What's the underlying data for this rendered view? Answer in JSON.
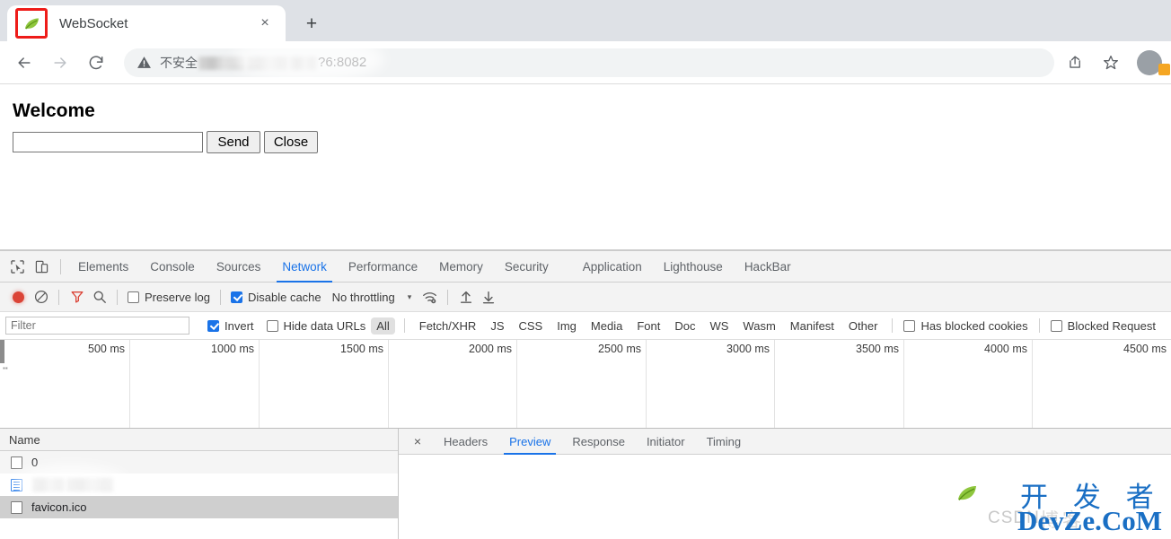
{
  "browser": {
    "tab": {
      "title": "WebSocket",
      "favicon": "spring-leaf-icon",
      "close_label": "×"
    },
    "new_tab_label": "+",
    "nav": {
      "back": "←",
      "forward": "→",
      "reload": "↻"
    },
    "omnibox": {
      "security_icon": "warning-triangle-icon",
      "security_text": "不安全",
      "url_visible_tail": "?6:8082",
      "url_redacted": true
    },
    "actions": {
      "share": "share-icon",
      "bookmark": "star-icon",
      "profile": "avatar"
    }
  },
  "page": {
    "heading": "Welcome",
    "message_input": {
      "value": "",
      "placeholder": ""
    },
    "send_label": "Send",
    "close_label": "Close"
  },
  "devtools": {
    "inspect_icon": "cursor-select-icon",
    "device_icon": "device-toggle-icon",
    "tabs": [
      {
        "label": "Elements",
        "active": false
      },
      {
        "label": "Console",
        "active": false
      },
      {
        "label": "Sources",
        "active": false
      },
      {
        "label": "Network",
        "active": true
      },
      {
        "label": "Performance",
        "active": false
      },
      {
        "label": "Memory",
        "active": false
      },
      {
        "label": "Security",
        "active": false
      },
      {
        "label": "Application",
        "active": false
      },
      {
        "label": "Lighthouse",
        "active": false
      },
      {
        "label": "HackBar",
        "active": false
      }
    ],
    "network_toolbar": {
      "record_icon": "record-button",
      "clear_icon": "clear-icon",
      "filter_icon": "filter-funnel-icon",
      "search_icon": "search-icon",
      "preserve_log": {
        "label": "Preserve log",
        "checked": false
      },
      "disable_cache": {
        "label": "Disable cache",
        "checked": true
      },
      "throttling": "No throttling",
      "caret": "▾",
      "wifi_icon": "network-conditions-icon",
      "import_icon": "import-har-icon",
      "export_icon": "export-har-icon"
    },
    "filter_bar": {
      "filter_placeholder": "Filter",
      "filter_value": "",
      "invert": {
        "label": "Invert",
        "checked": true
      },
      "hide_data_urls": {
        "label": "Hide data URLs",
        "checked": false
      },
      "types": [
        {
          "label": "All",
          "selected": true
        },
        {
          "label": "Fetch/XHR",
          "selected": false
        },
        {
          "label": "JS",
          "selected": false
        },
        {
          "label": "CSS",
          "selected": false
        },
        {
          "label": "Img",
          "selected": false
        },
        {
          "label": "Media",
          "selected": false
        },
        {
          "label": "Font",
          "selected": false
        },
        {
          "label": "Doc",
          "selected": false
        },
        {
          "label": "WS",
          "selected": false
        },
        {
          "label": "Wasm",
          "selected": false
        },
        {
          "label": "Manifest",
          "selected": false
        },
        {
          "label": "Other",
          "selected": false
        }
      ],
      "has_blocked_cookies": {
        "label": "Has blocked cookies",
        "checked": false
      },
      "blocked_requests": {
        "label": "Blocked Request",
        "checked": false
      }
    },
    "timeline": {
      "ticks": [
        "500 ms",
        "1000 ms",
        "1500 ms",
        "2000 ms",
        "2500 ms",
        "3000 ms",
        "3500 ms",
        "4000 ms",
        "4500 ms"
      ]
    },
    "requests": {
      "column_header": "Name",
      "rows": [
        {
          "name": "0",
          "icon": "file-icon",
          "redacted": false,
          "selected": false,
          "stripe": true
        },
        {
          "name": "",
          "icon": "document-icon",
          "redacted": true,
          "selected": false,
          "stripe": false
        },
        {
          "name": "favicon.ico",
          "icon": "file-icon",
          "redacted": false,
          "selected": true,
          "stripe": false
        }
      ]
    },
    "detail": {
      "close_label": "×",
      "tabs": [
        {
          "label": "Headers",
          "active": false
        },
        {
          "label": "Preview",
          "active": true
        },
        {
          "label": "Response",
          "active": false
        },
        {
          "label": "Initiator",
          "active": false
        },
        {
          "label": "Timing",
          "active": false
        }
      ]
    }
  },
  "watermark": {
    "leaf": "spring-leaf-icon",
    "cn": "开 发 者",
    "en": "DevZe.CoM",
    "csdn": "CSDN",
    "cn_faded": "博客",
    "color": "#1a6fc4"
  }
}
